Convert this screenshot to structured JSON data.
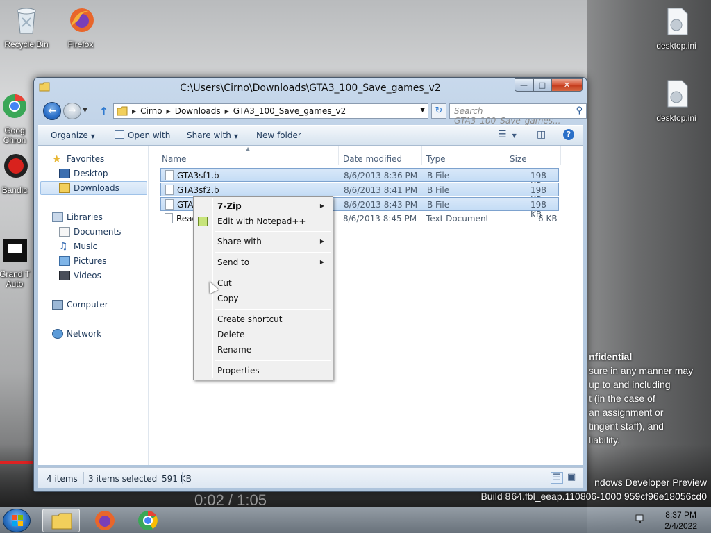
{
  "desktop": {
    "icons": [
      {
        "label": "Recycle Bin"
      },
      {
        "label": "Firefox"
      },
      {
        "label": "Goog\nChron"
      },
      {
        "label": "Bandic"
      },
      {
        "label": "Grand T\nAuto"
      },
      {
        "label": "desktop.ini"
      },
      {
        "label": "desktop.ini"
      }
    ],
    "confidential_head": "nfidential",
    "confidential_lines": [
      "sure in any manner may",
      "up to and including",
      "t (in the case of",
      "an assignment or",
      "tingent staff), and",
      "liability."
    ],
    "build_line1": "ndows Developer Preview",
    "build_line2": "Build 8 64.fbl_eeap.110806-1000 959cf96e18056cd0",
    "video_time": "0:02 / 1:05"
  },
  "window": {
    "title": "C:\\Users\\Cirno\\Downloads\\GTA3_100_Save_games_v2",
    "buttons": {
      "min": "—",
      "max": "□",
      "close": "✕"
    }
  },
  "navbar": {
    "breadcrumb": [
      "Cirno",
      "Downloads",
      "GTA3_100_Save_games_v2"
    ],
    "search_placeholder": "Search GTA3_100_Save_games..."
  },
  "toolbar": {
    "organize": "Organize",
    "open_with": "Open with",
    "share_with": "Share with",
    "new_folder": "New folder"
  },
  "navpane": {
    "favorites": "Favorites",
    "desktop": "Desktop",
    "downloads": "Downloads",
    "libraries": "Libraries",
    "documents": "Documents",
    "music": "Music",
    "pictures": "Pictures",
    "videos": "Videos",
    "computer": "Computer",
    "network": "Network"
  },
  "columns": {
    "name": "Name",
    "date": "Date modified",
    "type": "Type",
    "size": "Size"
  },
  "files": [
    {
      "name": "GTA3sf1.b",
      "date": "8/6/2013 8:36 PM",
      "type": "B File",
      "size": "198 KB"
    },
    {
      "name": "GTA3sf2.b",
      "date": "8/6/2013 8:41 PM",
      "type": "B File",
      "size": "198 KB"
    },
    {
      "name": "GTA3",
      "date": "8/6/2013 8:43 PM",
      "type": "B File",
      "size": "198 KB"
    },
    {
      "name": "Read",
      "date": "8/6/2013 8:45 PM",
      "type": "Text Document",
      "size": "6 KB"
    }
  ],
  "status": {
    "items": "4 items",
    "selected": "3 items selected",
    "size": "591 KB"
  },
  "context_menu": {
    "zip": "7-Zip",
    "npp": "Edit with Notepad++",
    "share_with": "Share with",
    "send_to": "Send to",
    "cut": "Cut",
    "copy": "Copy",
    "create_shortcut": "Create shortcut",
    "delete": "Delete",
    "rename": "Rename",
    "properties": "Properties"
  },
  "taskbar": {
    "time": "8:37 PM",
    "date": "2/4/2022"
  },
  "colors": {
    "accent": "#2a6fc8",
    "selection": "#c4dcf5",
    "close": "#c43c1d"
  }
}
